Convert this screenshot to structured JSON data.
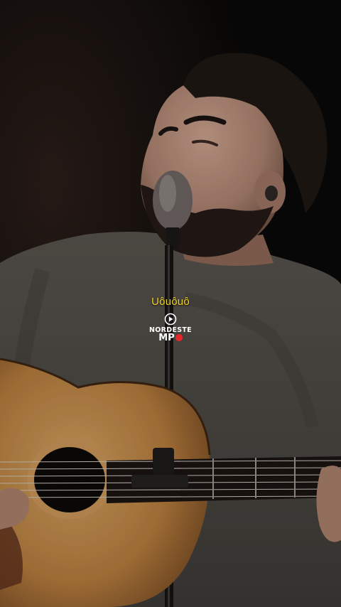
{
  "video": {
    "lyric": "Uôuôuô",
    "watermark": {
      "line1": "NORDESTE",
      "line2": "MP",
      "accent_color": "#e8252b",
      "icon": "play-circle-icon"
    }
  },
  "colors": {
    "background": "#0a0908",
    "lyric": "#f2d21b"
  }
}
